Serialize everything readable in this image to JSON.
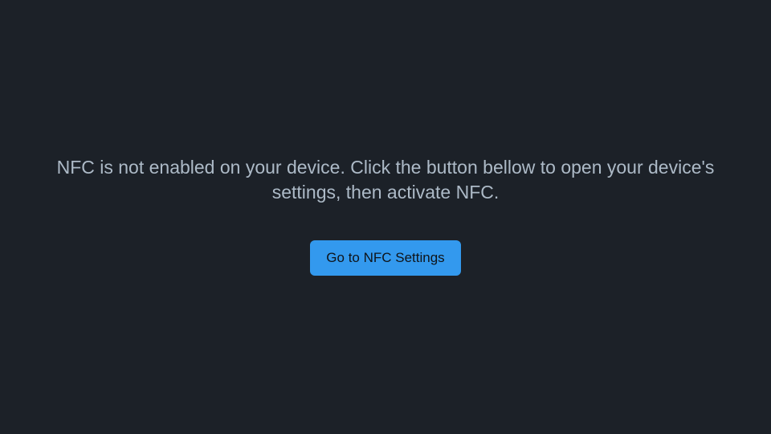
{
  "message": "NFC is not enabled on your device. Click the button bellow to open your device's settings, then activate NFC.",
  "button_label": "Go to NFC Settings"
}
